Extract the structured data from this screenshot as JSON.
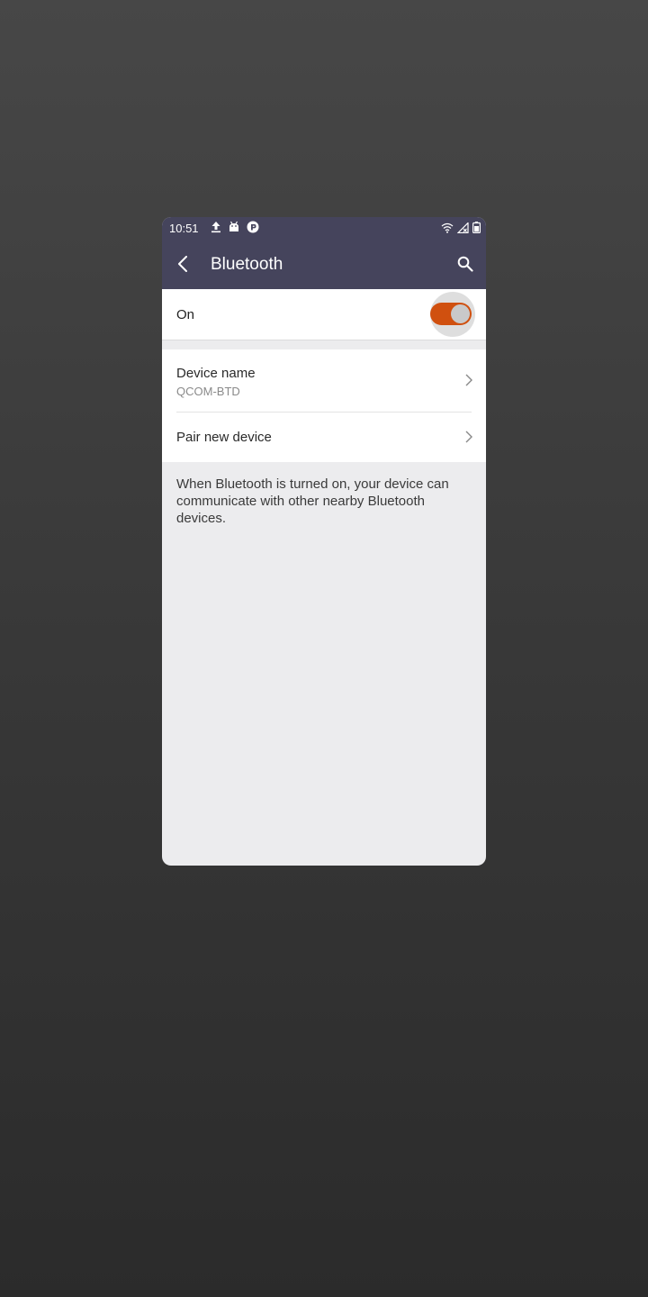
{
  "status_bar": {
    "time": "10:51",
    "left_icons": [
      "upload-icon",
      "android-icon",
      "sync-icon"
    ],
    "right_icons": [
      "wifi-icon",
      "cell-signal-icon",
      "battery-icon"
    ]
  },
  "app_bar": {
    "title": "Bluetooth",
    "back_icon": "back-arrow-icon",
    "search_icon": "search-icon",
    "background": "#45445c"
  },
  "bluetooth_toggle": {
    "label": "On",
    "state": "on",
    "accent": "#d0500f"
  },
  "settings": {
    "device_name": {
      "title": "Device name",
      "value": "QCOM-BTD"
    },
    "pair": {
      "title": "Pair new device"
    }
  },
  "footer": {
    "text": "When Bluetooth is turned on, your device can communicate with other nearby Bluetooth devices."
  }
}
